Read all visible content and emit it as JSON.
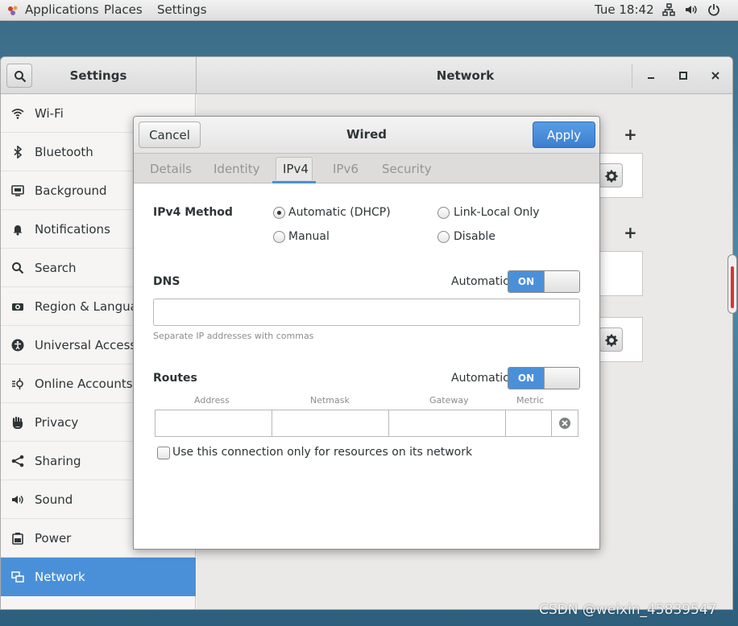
{
  "topbar": {
    "applications": "Applications",
    "places": "Places",
    "settings": "Settings",
    "clock": "Tue 18:42",
    "icons": [
      "network-icon",
      "volume-icon",
      "power-icon"
    ]
  },
  "window": {
    "sidebar_title": "Settings",
    "main_title": "Network"
  },
  "sidebar": {
    "items": [
      {
        "label": "Wi-Fi",
        "icon": "wifi-icon"
      },
      {
        "label": "Bluetooth",
        "icon": "bluetooth-icon"
      },
      {
        "label": "Background",
        "icon": "background-icon"
      },
      {
        "label": "Notifications",
        "icon": "bell-icon"
      },
      {
        "label": "Search",
        "icon": "search-icon"
      },
      {
        "label": "Region & Language",
        "icon": "camera-icon"
      },
      {
        "label": "Universal Access",
        "icon": "accessibility-icon"
      },
      {
        "label": "Online Accounts",
        "icon": "online-accounts-icon"
      },
      {
        "label": "Privacy",
        "icon": "hand-icon"
      },
      {
        "label": "Sharing",
        "icon": "share-icon"
      },
      {
        "label": "Sound",
        "icon": "speaker-icon"
      },
      {
        "label": "Power",
        "icon": "battery-icon"
      },
      {
        "label": "Network",
        "icon": "network-icon",
        "active": true
      }
    ]
  },
  "dialog": {
    "title": "Wired",
    "cancel": "Cancel",
    "apply": "Apply",
    "tabs": [
      "Details",
      "Identity",
      "IPv4",
      "IPv6",
      "Security"
    ],
    "active_tab": "IPv4",
    "ipv4_method_label": "IPv4 Method",
    "methods": {
      "auto": "Automatic (DHCP)",
      "link_local": "Link-Local Only",
      "manual": "Manual",
      "disable": "Disable"
    },
    "selected_method": "Automatic (DHCP)",
    "dns": {
      "label": "DNS",
      "automatic_label": "Automatic",
      "switch": "ON",
      "value": "",
      "hint": "Separate IP addresses with commas"
    },
    "routes": {
      "label": "Routes",
      "automatic_label": "Automatic",
      "switch": "ON",
      "columns": [
        "Address",
        "Netmask",
        "Gateway",
        "Metric"
      ]
    },
    "checkbox_label": "Use this connection only for resources on its network",
    "checkbox_checked": false
  },
  "watermark": "CSDN @weixin_45839547",
  "colors": {
    "accent": "#4a90d9",
    "sidebar_bg": "#f6f5f4"
  }
}
